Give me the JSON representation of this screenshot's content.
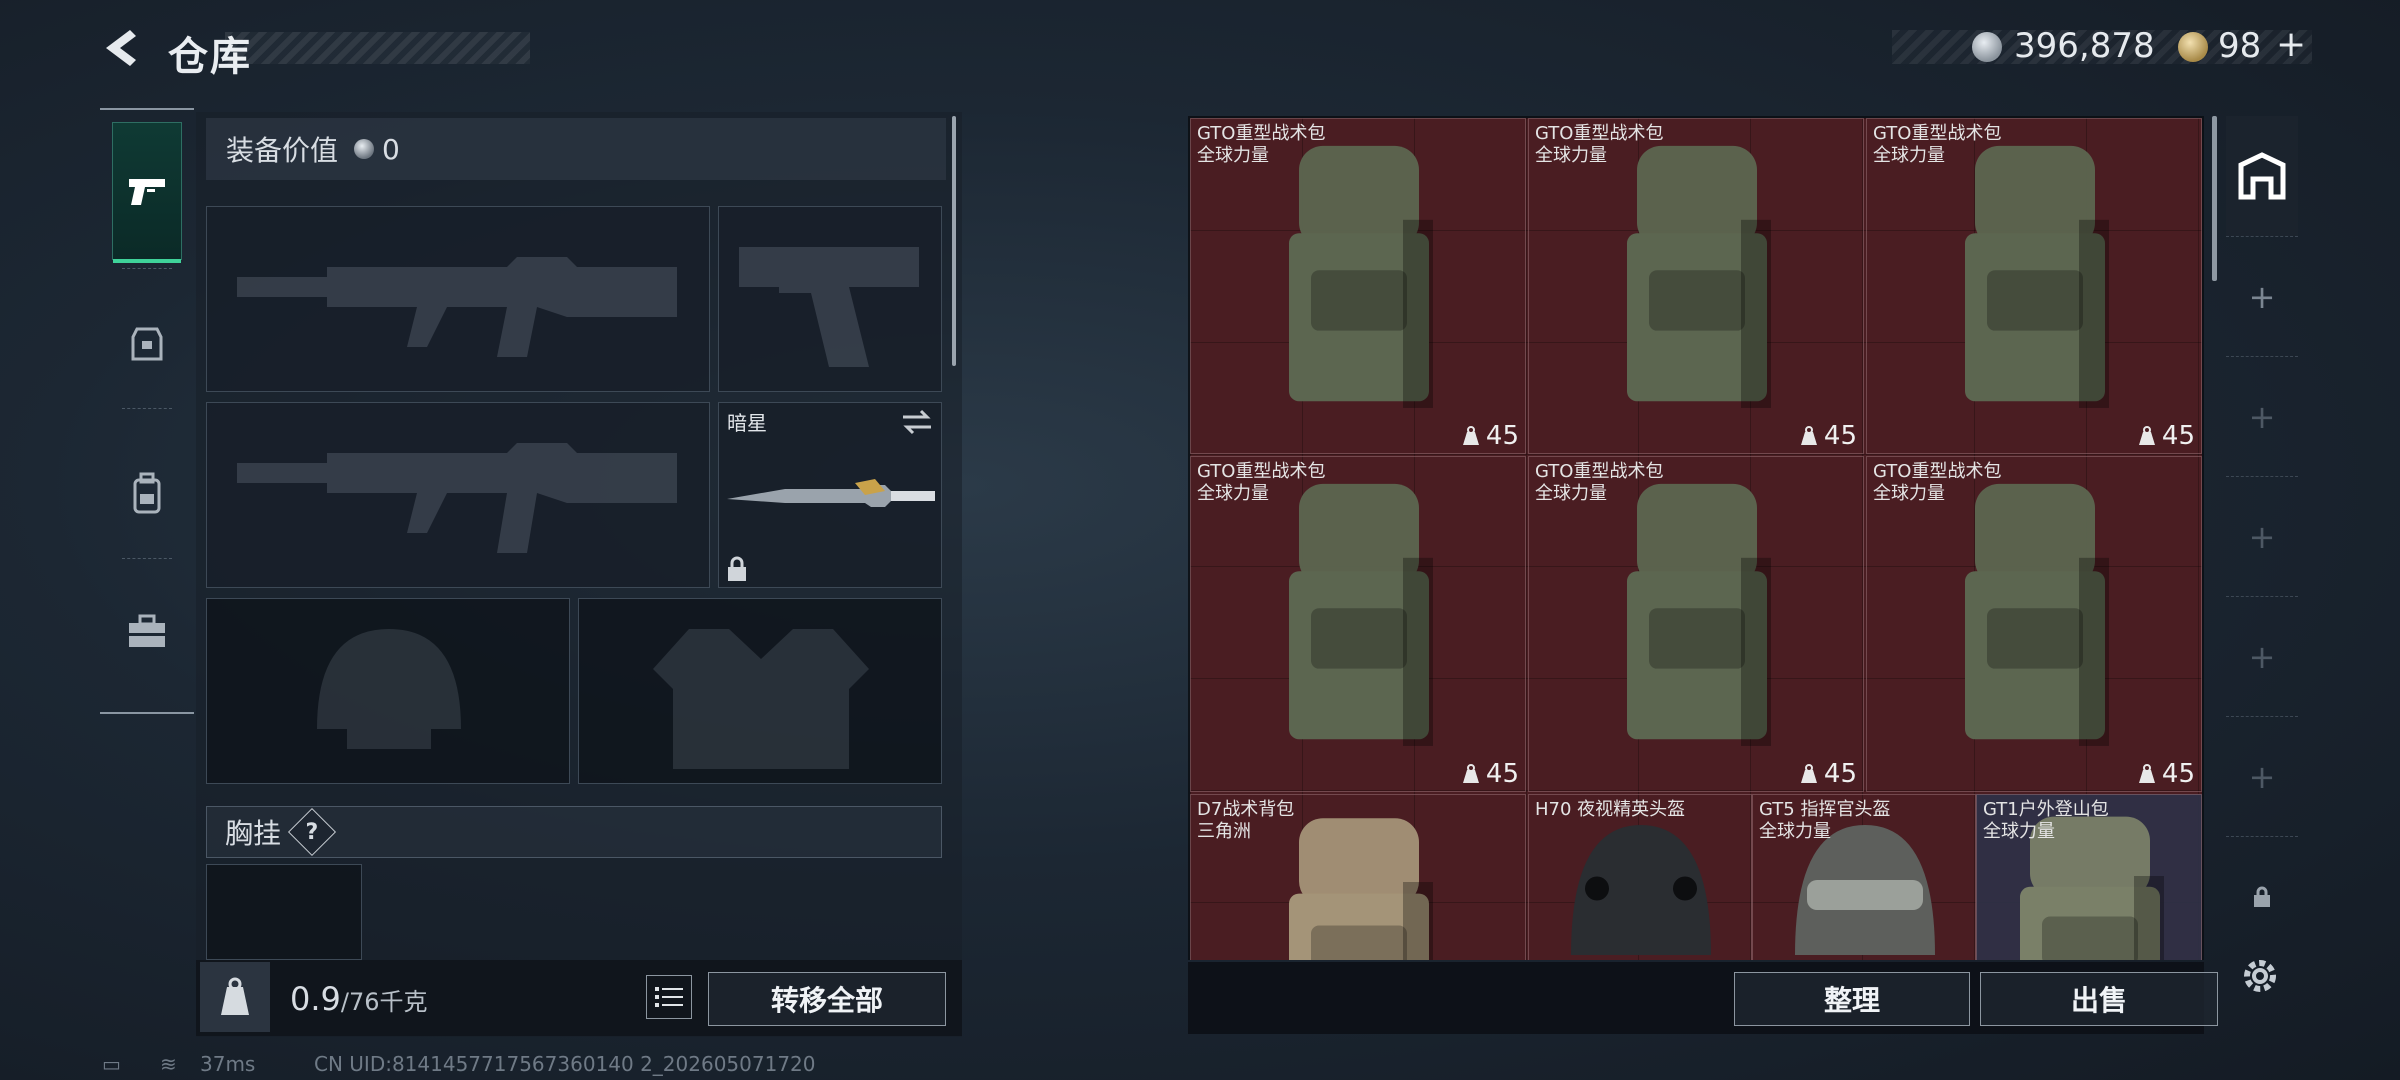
{
  "header": {
    "title": "仓库"
  },
  "currency": {
    "silver": "396,878",
    "gold": "98",
    "gold_plus": "+"
  },
  "nav": {
    "items": [
      "weapons",
      "armor",
      "backpack",
      "supplies"
    ]
  },
  "equipment": {
    "value_label": "装备价值",
    "value": "0",
    "melee_name": "暗星",
    "chest_label": "胸挂",
    "chest_help": "?",
    "weight_current": "0.9",
    "weight_max": "/76千克",
    "transfer_all": "转移全部"
  },
  "status": {
    "ping": "37ms",
    "uid": "CN UID:8141457717567360140 2_202605071720"
  },
  "storage": {
    "items": [
      {
        "name": "GTO重型战术包",
        "sub": "全球力量",
        "count": "45"
      },
      {
        "name": "GTO重型战术包",
        "sub": "全球力量",
        "count": "45"
      },
      {
        "name": "GTO重型战术包",
        "sub": "全球力量",
        "count": "45"
      },
      {
        "name": "GTO重型战术包",
        "sub": "全球力量",
        "count": "45"
      },
      {
        "name": "GTO重型战术包",
        "sub": "全球力量",
        "count": "45"
      },
      {
        "name": "GTO重型战术包",
        "sub": "全球力量",
        "count": "45"
      },
      {
        "name": "D7战术背包",
        "sub": "三角洲",
        "count": ""
      },
      {
        "name": "H70 夜视精英头盔",
        "sub": "",
        "count": ""
      },
      {
        "name": "GT5 指挥官头盔",
        "sub": "全球力量",
        "count": ""
      },
      {
        "name": "GT1户外登山包",
        "sub": "全球力量",
        "count": ""
      }
    ],
    "sort": "整理",
    "sell": "出售"
  }
}
